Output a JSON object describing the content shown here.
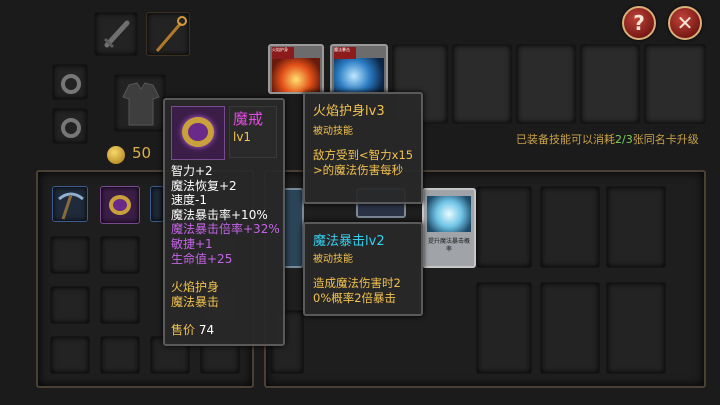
{
  "top_buttons": {
    "help_label": "?",
    "close_label": "✕"
  },
  "gold": {
    "amount": "50"
  },
  "upgrade_hint": {
    "prefix": "已装备技能可以消耗",
    "count": "2/3",
    "suffix": "张同名卡升级"
  },
  "item_tooltip": {
    "name": "魔戒",
    "level": "lv1",
    "base_stats": [
      "智力+2",
      "魔法恢复+2",
      "速度-1",
      "魔法暴击率+10%"
    ],
    "magic_stats": [
      "魔法暴击倍率+32%",
      "敏捷+1",
      "生命值+25"
    ],
    "skills": [
      "火焰护身",
      "魔法暴击"
    ],
    "price_label": "售价",
    "price_value": "74"
  },
  "skill_tooltip_1": {
    "name": "火焰护身",
    "level": "lv3",
    "type": "被动技能",
    "description": "敌方受到<智力x15>的魔法伤害每秒"
  },
  "skill_tooltip_2": {
    "name": "魔法暴击",
    "level": "lv2",
    "type": "被动技能",
    "description": "造成魔法伤害时20%概率2倍暴击"
  },
  "skill_card_texts": {
    "top_card_1_badge": "火焰护身",
    "top_card_2_badge": "魔法暴击",
    "right_card_caption": "提升魔法暴击概率"
  },
  "colors": {
    "gold_text": "#f1c24f",
    "magic_text": "#c564e8",
    "skill_title": "#f1c24f",
    "skill_title_2": "#33d0f0",
    "hint_text": "#c9a24a",
    "hint_count": "#7ad25a"
  }
}
